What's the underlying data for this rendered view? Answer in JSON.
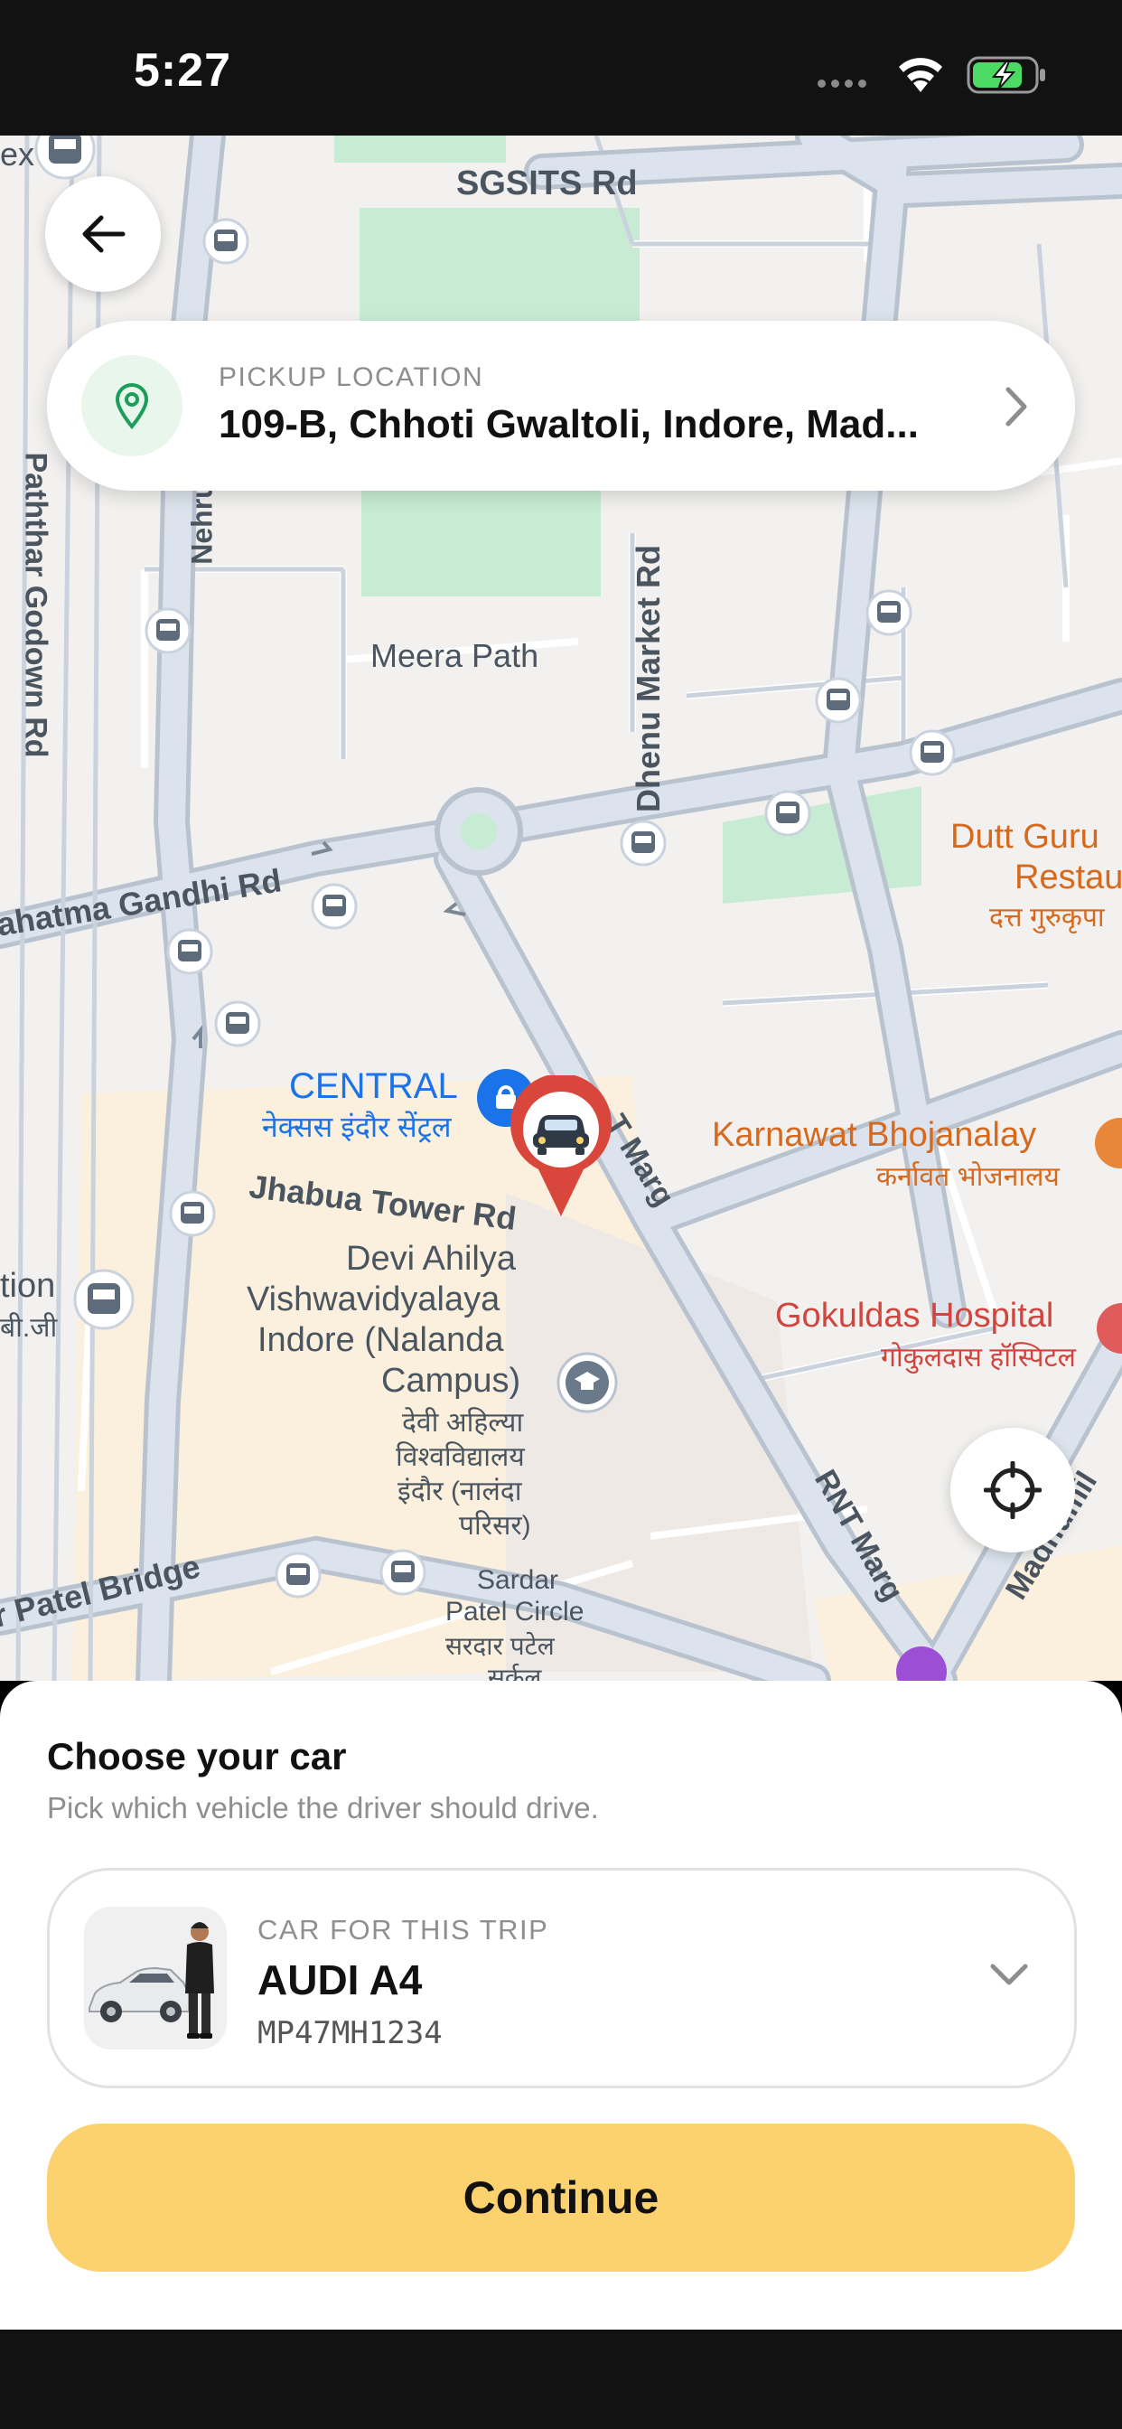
{
  "status_bar": {
    "time": "5:27"
  },
  "map": {
    "roads": {
      "sgsits": "SGSITS Rd",
      "paththar": "Paththar Godown Rd",
      "nehru": "Nehru",
      "meera": "Meera Path",
      "dhenu": "Dhenu Market Rd",
      "mg": "ahatma Gandhi Rd",
      "jhabua": "Jhabua Tower Rd",
      "rnt_upper": "T Marg",
      "rnt_lower": "RNT Marg",
      "patel_bridge": "r Patel Bridge",
      "madhumilan": "Madhumil"
    },
    "places": {
      "central_en": "CENTRAL",
      "central_hi": "नेक्सस इंदौर सेंट्रल",
      "dutt_1": "Dutt Guru",
      "dutt_2": "Restau",
      "dutt_hi": "दत्त गुरुकृपा",
      "karnawat_en": "Karnawat Bhojanalay",
      "karnawat_hi": "कर्नावत भोजनालय",
      "gokuldas_en": "Gokuldas Hospital",
      "gokuldas_hi": "गोकुलदास हॉस्पिटल",
      "davv_1": "Devi Ahilya",
      "davv_2": "Vishwavidyalaya",
      "davv_3": "Indore (Nalanda",
      "davv_4": "Campus)",
      "davv_hi_1": "देवी अहिल्या",
      "davv_hi_2": "विश्वविद्यालय",
      "davv_hi_3": "इंदौर (नालंदा",
      "davv_hi_4": "परिसर)",
      "sardar_1": "Sardar",
      "sardar_2": "Patel Circle",
      "sardar_hi_1": "सरदार पटेल",
      "sardar_hi_2": "सर्कल",
      "station_en": "tion",
      "station_hi": "बी.जी",
      "ex": "ex"
    }
  },
  "pickup": {
    "label": "PICKUP LOCATION",
    "address": "109-B, Chhoti Gwaltoli, Indore, Mad..."
  },
  "sheet": {
    "title": "Choose your car",
    "subtitle": "Pick which vehicle the driver should drive.",
    "car_label": "CAR FOR THIS TRIP",
    "car_name": "AUDI A4",
    "car_plate": "MP47MH1234",
    "continue_label": "Continue"
  },
  "colors": {
    "accent_yellow": "#fcd26e",
    "pin_red": "#d9473c",
    "pin_green": "#1a9e5a",
    "map_bg": "#f2f1ef",
    "road": "#c9d2dd",
    "park": "#c8ecd3"
  },
  "icons": {
    "back": "arrow-left-icon",
    "pickup": "location-pin-icon",
    "chevron_right": "chevron-right-icon",
    "chevron_down": "chevron-down-icon",
    "locate": "crosshair-icon",
    "car_marker": "car-pin-icon"
  }
}
